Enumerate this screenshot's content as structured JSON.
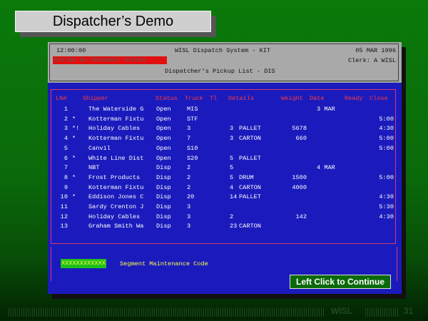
{
  "slide": {
    "title": "Dispatcher’s Demo",
    "footer_label": "WISL",
    "page_number": "31"
  },
  "header": {
    "time": "12:00:00",
    "app_title": "WISL Dispatch System - KIT",
    "date": "05 MAR 1996",
    "sort_status": "Sorted by Shipment Status",
    "clerk": "Clerk: A WISL",
    "list_title": "Dispatcher's Pickup List - DIS"
  },
  "columns": {
    "ln": "LN#",
    "shipper": "Shipper",
    "status": "Status",
    "truck": "Truck",
    "tl": "Tl",
    "details": "Details",
    "weight": "Weight",
    "date": "Date",
    "ready": "Ready",
    "close": "Close"
  },
  "rows": [
    {
      "ln": "1",
      "flag": "",
      "shipper": "The Waterside G",
      "status": "Open",
      "truck": "MIS",
      "tl": "",
      "details": "",
      "weight": "",
      "date": "3 MAR",
      "close": ""
    },
    {
      "ln": "2",
      "flag": "*",
      "shipper": "Kotterman Fixtu",
      "status": "Open",
      "truck": "STF",
      "tl": "",
      "details": "",
      "weight": "",
      "date": "",
      "close": "5:00"
    },
    {
      "ln": "3",
      "flag": "*!",
      "shipper": "Holiday Cables",
      "status": "Open",
      "truck": "3",
      "tl": "3",
      "details": "PALLET",
      "weight": "5678",
      "date": "",
      "close": "4:30"
    },
    {
      "ln": "4",
      "flag": "*",
      "shipper": "Kotterman Fixtu",
      "status": "Open",
      "truck": "7",
      "tl": "3",
      "details": "CARTON",
      "weight": "660",
      "date": "",
      "close": "5:00"
    },
    {
      "ln": "5",
      "flag": "",
      "shipper": "Canvil",
      "status": "Open",
      "truck": "S10",
      "tl": "",
      "details": "",
      "weight": "",
      "date": "",
      "close": "5:00"
    },
    {
      "ln": "6",
      "flag": "*",
      "shipper": "White Line Dist",
      "status": "Open",
      "truck": "S20",
      "tl": "5",
      "details": "PALLET",
      "weight": "",
      "date": "",
      "close": ""
    },
    {
      "ln": "7",
      "flag": "",
      "shipper": "NBT",
      "status": "Disp",
      "truck": "2",
      "tl": "5",
      "details": "",
      "weight": "",
      "date": "4 MAR",
      "close": ""
    },
    {
      "ln": "8",
      "flag": "*",
      "shipper": "Frost Products",
      "status": "Disp",
      "truck": "2",
      "tl": "5",
      "details": "DRUM",
      "weight": "1500",
      "date": "",
      "close": "5:00"
    },
    {
      "ln": "9",
      "flag": "",
      "shipper": "Kotterman Fixtu",
      "status": "Disp",
      "truck": "2",
      "tl": "4",
      "details": "CARTON",
      "weight": "4000",
      "date": "",
      "close": ""
    },
    {
      "ln": "10",
      "flag": "*",
      "shipper": "Eddison Jones C",
      "status": "Disp",
      "truck": "20",
      "tl": "14",
      "details": "PALLET",
      "weight": "",
      "date": "",
      "close": "4:30"
    },
    {
      "ln": "11",
      "flag": "",
      "shipper": "Sardy Crenton J",
      "status": "Disp",
      "truck": "3",
      "tl": "",
      "details": "",
      "weight": "",
      "date": "",
      "close": "5:30"
    },
    {
      "ln": "12",
      "flag": "",
      "shipper": "Holiday Cables",
      "status": "Disp",
      "truck": "3",
      "tl": "2",
      "details": "",
      "weight": "142",
      "date": "",
      "close": "4:30"
    },
    {
      "ln": "13",
      "flag": "",
      "shipper": "Graham Smith Wa",
      "status": "Disp",
      "truck": "3",
      "tl": "23",
      "details": "CARTON",
      "weight": "",
      "date": "",
      "close": ""
    }
  ],
  "segment": {
    "code_value": "XXXXXXXXXXXX",
    "label": "Segment Maintenance Code"
  },
  "continue_button": "Left Click to Continue",
  "colors": {
    "screen_bg": "#1b1bbd",
    "header_bg": "#a9a9a9",
    "accent_red": "#ff3a3a",
    "highlight_yellow": "#ffff44",
    "button_green": "#0b6a0b"
  }
}
